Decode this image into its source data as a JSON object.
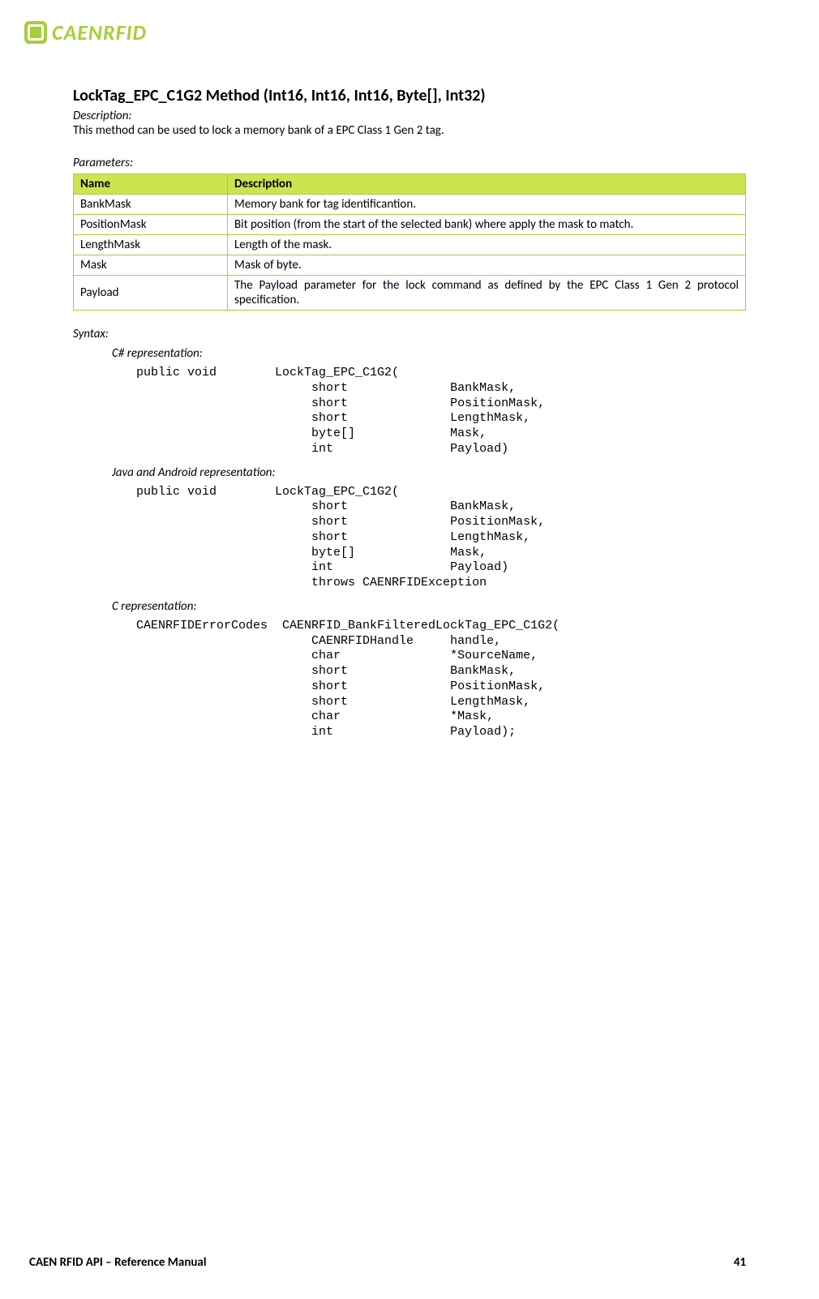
{
  "brand": "CAENRFID",
  "method": {
    "title": "LockTag_EPC_C1G2 Method (Int16, Int16, Int16, Byte[], Int32)",
    "description_label": "Description:",
    "description_text": "This method can be used to lock a memory bank of a EPC Class 1 Gen 2 tag.",
    "parameters_label": "Parameters:",
    "table": {
      "head_name": "Name",
      "head_desc": "Description",
      "rows": [
        {
          "name": "BankMask",
          "desc": "Memory bank for tag identificantion."
        },
        {
          "name": "PositionMask",
          "desc": "Bit position (from the start of the selected bank) where apply the mask to match."
        },
        {
          "name": "LengthMask",
          "desc": "Length of the mask."
        },
        {
          "name": "Mask",
          "desc": "Mask of byte."
        },
        {
          "name": "Payload",
          "desc": "The Payload parameter for the lock command as defined by the EPC Class 1 Gen 2 protocol specification."
        }
      ]
    },
    "syntax_label": "Syntax:",
    "csharp_label": "C# representation:",
    "csharp_code": "public void        LockTag_EPC_C1G2(\n                        short              BankMask,\n                        short              PositionMask,\n                        short              LengthMask,\n                        byte[]             Mask,\n                        int                Payload)",
    "java_label": "Java and Android representation:",
    "java_code": "public void        LockTag_EPC_C1G2(\n                        short              BankMask,\n                        short              PositionMask,\n                        short              LengthMask,\n                        byte[]             Mask,\n                        int                Payload)\n                        throws CAENRFIDException",
    "c_label": "C representation:",
    "c_code": "CAENRFIDErrorCodes  CAENRFID_BankFilteredLockTag_EPC_C1G2(\n                        CAENRFIDHandle     handle,\n                        char               *SourceName,\n                        short              BankMask,\n                        short              PositionMask,\n                        short              LengthMask,\n                        char               *Mask,\n                        int                Payload);"
  },
  "footer": {
    "left": "CAEN RFID API – Reference Manual",
    "right": "41"
  }
}
